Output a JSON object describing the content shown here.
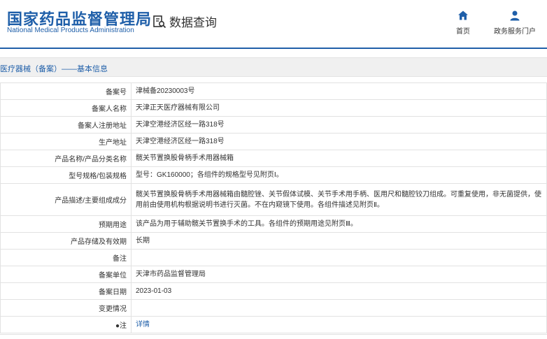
{
  "header": {
    "logo_cn": "国家药品监督管理局",
    "logo_en": "National Medical Products Administration",
    "query_label": "数据查询",
    "nav": [
      {
        "label": "首页",
        "icon": "home-icon"
      },
      {
        "label": "政务服务门户",
        "icon": "user-icon"
      }
    ]
  },
  "breadcrumb": "医疗器械（备案）——基本信息",
  "rows": [
    {
      "label": "备案号",
      "value": "津械备20230003号"
    },
    {
      "label": "备案人名称",
      "value": "天津正天医疗器械有限公司"
    },
    {
      "label": "备案人注册地址",
      "value": "天津空港经济区经一路318号"
    },
    {
      "label": "生产地址",
      "value": "天津空港经济区经一路318号"
    },
    {
      "label": "产品名称/产品分类名称",
      "value": "髋关节置换股骨柄手术用器械箱"
    },
    {
      "label": "型号规格/包装规格",
      "value": "型号：GK160000；各组件的规格型号见附页Ⅰ。"
    },
    {
      "label": "产品描述/主要组成成分",
      "value": "髋关节置换股骨柄手术用器械箱由髓腔锉、关节假体试模、关节手术用手柄、医用尺和髓腔铰刀组成。可重复使用，非无菌提供，使用前由使用机构根据说明书进行灭菌。不在内窥镜下使用。各组件描述见附页Ⅱ。"
    },
    {
      "label": "预期用途",
      "value": "该产品为用于辅助髋关节置换手术的工具。各组件的预期用途见附页Ⅲ。"
    },
    {
      "label": "产品存储及有效期",
      "value": "长期"
    },
    {
      "label": "备注",
      "value": ""
    },
    {
      "label": "备案单位",
      "value": "天津市药品监督管理局"
    },
    {
      "label": "备案日期",
      "value": "2023-01-03"
    },
    {
      "label": "变更情况",
      "value": ""
    },
    {
      "label": "●注",
      "value": "详情"
    }
  ]
}
